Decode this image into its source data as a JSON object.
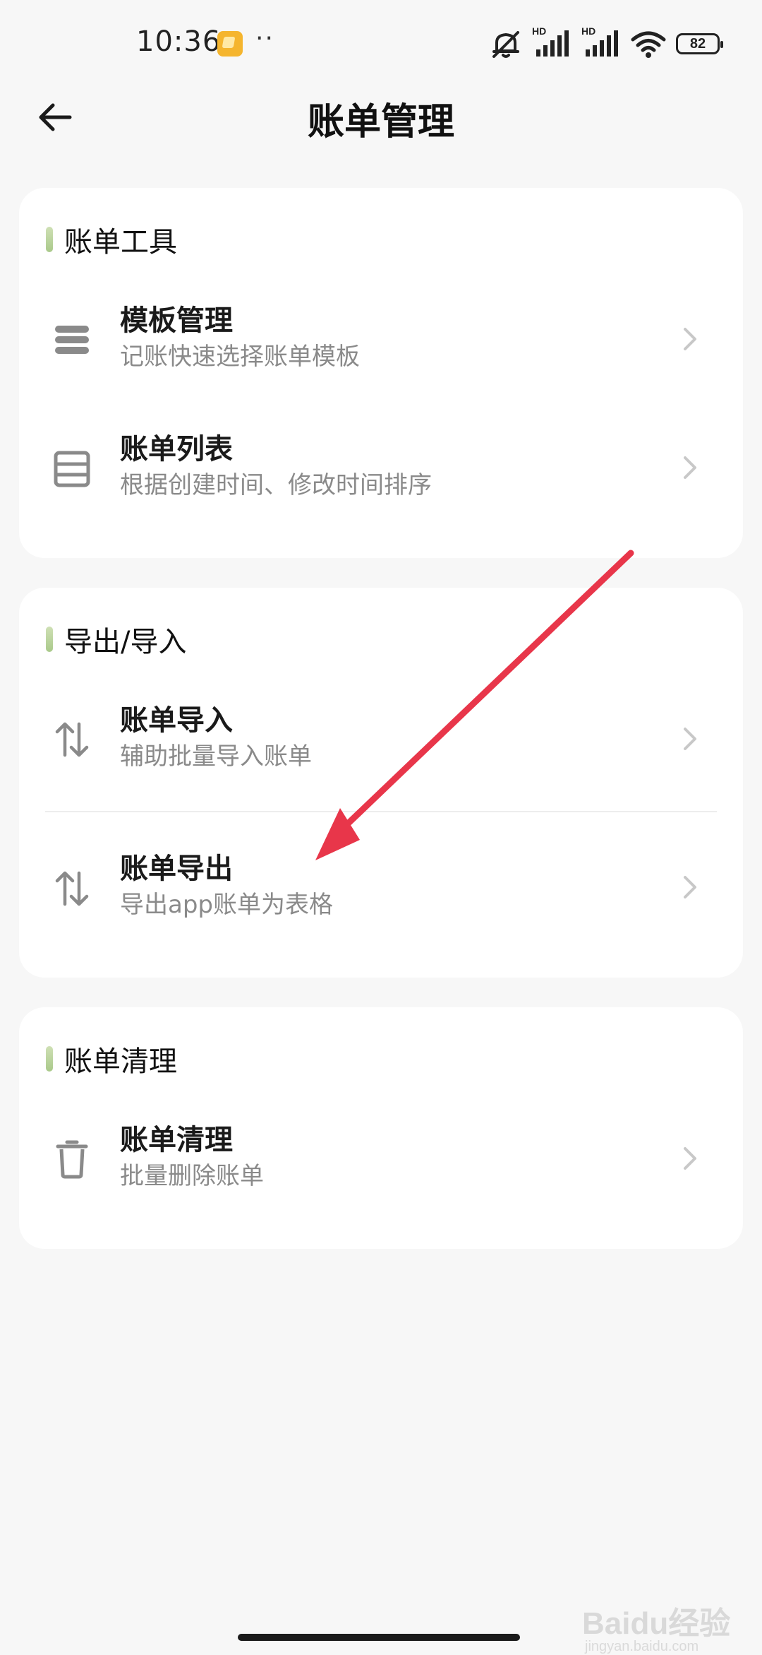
{
  "status_bar": {
    "time": "10:36",
    "more": "··",
    "battery": "82",
    "signal_label_1": "HD",
    "signal_label_2": "HD"
  },
  "header": {
    "title": "账单管理"
  },
  "sections": [
    {
      "title": "账单工具",
      "items": [
        {
          "title": "模板管理",
          "subtitle": "记账快速选择账单模板",
          "icon": "template-stack-icon"
        },
        {
          "title": "账单列表",
          "subtitle": "根据创建时间、修改时间排序",
          "icon": "list-icon"
        }
      ]
    },
    {
      "title": "导出/导入",
      "items": [
        {
          "title": "账单导入",
          "subtitle": "辅助批量导入账单",
          "icon": "import-arrows-icon"
        },
        {
          "title": "账单导出",
          "subtitle": "导出app账单为表格",
          "icon": "export-arrows-icon"
        }
      ]
    },
    {
      "title": "账单清理",
      "items": [
        {
          "title": "账单清理",
          "subtitle": "批量删除账单",
          "icon": "trash-icon"
        }
      ]
    }
  ],
  "watermark": {
    "text": "Baidu经验",
    "sub": "jingyan.baidu.com"
  },
  "colors": {
    "background": "#F7F7F7",
    "card": "#FFFFFF",
    "annotation_arrow": "#E8364A",
    "section_marker": "#B8D29C"
  }
}
